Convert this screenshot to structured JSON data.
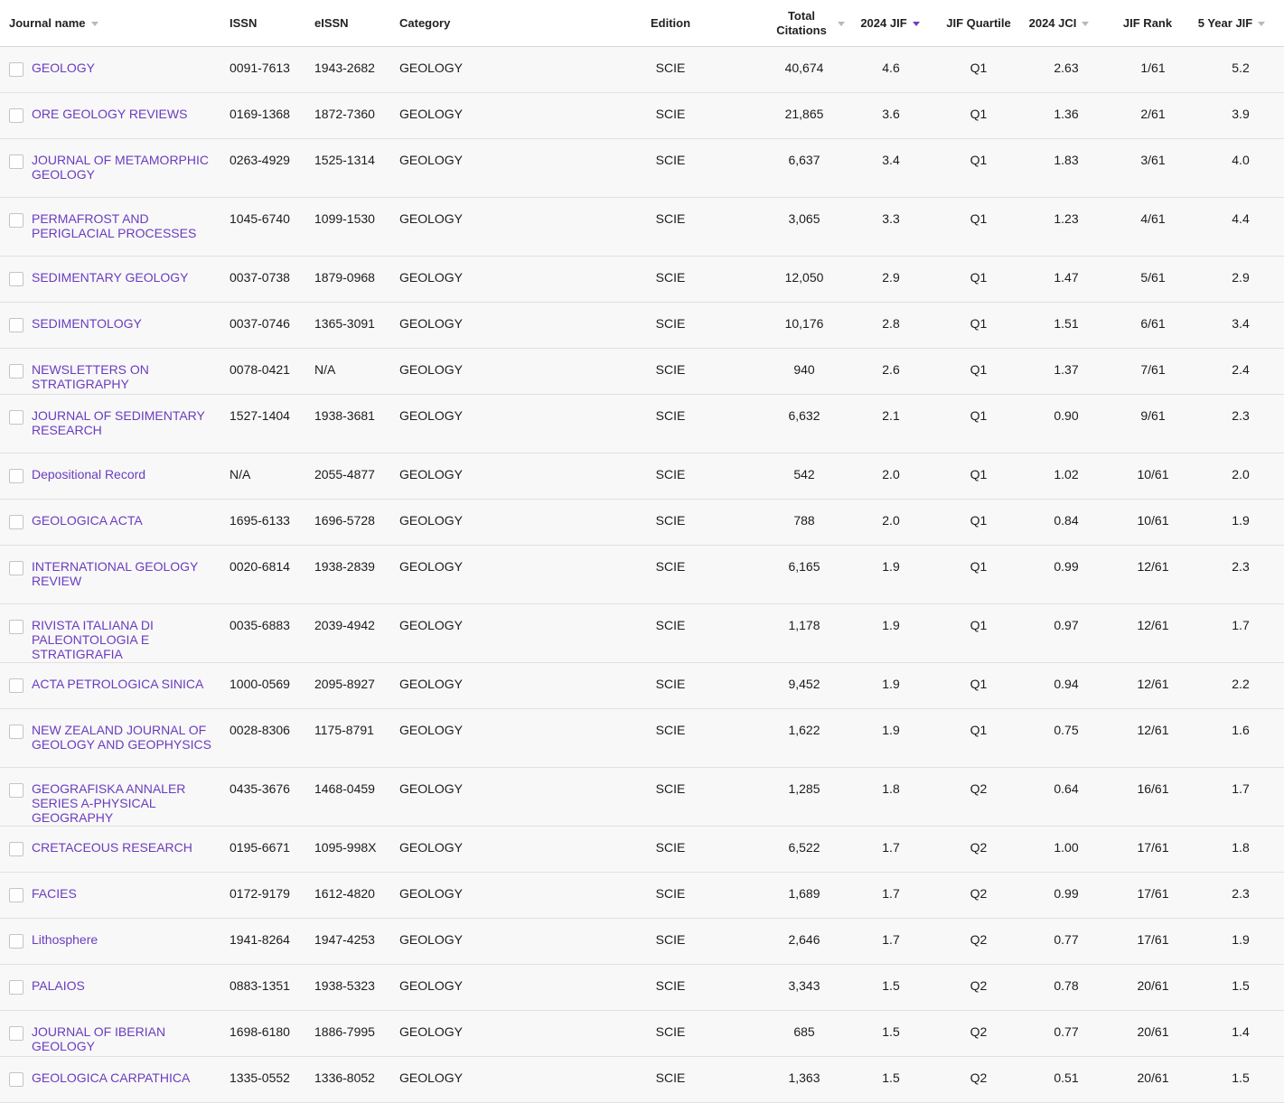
{
  "headers": {
    "journal_name": "Journal name",
    "issn": "ISSN",
    "eissn": "eISSN",
    "category": "Category",
    "edition": "Edition",
    "total_citations_line1": "Total",
    "total_citations_line2": "Citations",
    "jif": "2024 JIF",
    "jif_quartile": "JIF Quartile",
    "jci": "2024 JCI",
    "jif_rank": "JIF Rank",
    "five_year_jif": "5 Year JIF"
  },
  "sort": {
    "active_column": "2024 JIF",
    "active_color": "#6b3fc4",
    "inactive_color": "#b8b8b8"
  },
  "link_color": "#6a3cbf",
  "rows": [
    {
      "name": "GEOLOGY",
      "issn": "0091-7613",
      "eissn": "1943-2682",
      "category": "GEOLOGY",
      "edition": "SCIE",
      "citations": "40,674",
      "jif": "4.6",
      "quartile": "Q1",
      "jci": "2.63",
      "rank": "1/61",
      "five_year": "5.2"
    },
    {
      "name": "ORE GEOLOGY REVIEWS",
      "issn": "0169-1368",
      "eissn": "1872-7360",
      "category": "GEOLOGY",
      "edition": "SCIE",
      "citations": "21,865",
      "jif": "3.6",
      "quartile": "Q1",
      "jci": "1.36",
      "rank": "2/61",
      "five_year": "3.9"
    },
    {
      "name": "JOURNAL OF METAMORPHIC GEOLOGY",
      "issn": "0263-4929",
      "eissn": "1525-1314",
      "category": "GEOLOGY",
      "edition": "SCIE",
      "citations": "6,637",
      "jif": "3.4",
      "quartile": "Q1",
      "jci": "1.83",
      "rank": "3/61",
      "five_year": "4.0"
    },
    {
      "name": "PERMAFROST AND PERIGLACIAL PROCESSES",
      "issn": "1045-6740",
      "eissn": "1099-1530",
      "category": "GEOLOGY",
      "edition": "SCIE",
      "citations": "3,065",
      "jif": "3.3",
      "quartile": "Q1",
      "jci": "1.23",
      "rank": "4/61",
      "five_year": "4.4"
    },
    {
      "name": "SEDIMENTARY GEOLOGY",
      "issn": "0037-0738",
      "eissn": "1879-0968",
      "category": "GEOLOGY",
      "edition": "SCIE",
      "citations": "12,050",
      "jif": "2.9",
      "quartile": "Q1",
      "jci": "1.47",
      "rank": "5/61",
      "five_year": "2.9"
    },
    {
      "name": "SEDIMENTOLOGY",
      "issn": "0037-0746",
      "eissn": "1365-3091",
      "category": "GEOLOGY",
      "edition": "SCIE",
      "citations": "10,176",
      "jif": "2.8",
      "quartile": "Q1",
      "jci": "1.51",
      "rank": "6/61",
      "five_year": "3.4"
    },
    {
      "name": "NEWSLETTERS ON STRATIGRAPHY",
      "issn": "0078-0421",
      "eissn": "N/A",
      "category": "GEOLOGY",
      "edition": "SCIE",
      "citations": "940",
      "jif": "2.6",
      "quartile": "Q1",
      "jci": "1.37",
      "rank": "7/61",
      "five_year": "2.4"
    },
    {
      "name": "JOURNAL OF SEDIMENTARY RESEARCH",
      "issn": "1527-1404",
      "eissn": "1938-3681",
      "category": "GEOLOGY",
      "edition": "SCIE",
      "citations": "6,632",
      "jif": "2.1",
      "quartile": "Q1",
      "jci": "0.90",
      "rank": "9/61",
      "five_year": "2.3"
    },
    {
      "name": "Depositional Record",
      "issn": "N/A",
      "eissn": "2055-4877",
      "category": "GEOLOGY",
      "edition": "SCIE",
      "citations": "542",
      "jif": "2.0",
      "quartile": "Q1",
      "jci": "1.02",
      "rank": "10/61",
      "five_year": "2.0"
    },
    {
      "name": "GEOLOGICA ACTA",
      "issn": "1695-6133",
      "eissn": "1696-5728",
      "category": "GEOLOGY",
      "edition": "SCIE",
      "citations": "788",
      "jif": "2.0",
      "quartile": "Q1",
      "jci": "0.84",
      "rank": "10/61",
      "five_year": "1.9"
    },
    {
      "name": "INTERNATIONAL GEOLOGY REVIEW",
      "issn": "0020-6814",
      "eissn": "1938-2839",
      "category": "GEOLOGY",
      "edition": "SCIE",
      "citations": "6,165",
      "jif": "1.9",
      "quartile": "Q1",
      "jci": "0.99",
      "rank": "12/61",
      "five_year": "2.3"
    },
    {
      "name": "RIVISTA ITALIANA DI PALEONTOLOGIA E STRATIGRAFIA",
      "issn": "0035-6883",
      "eissn": "2039-4942",
      "category": "GEOLOGY",
      "edition": "SCIE",
      "citations": "1,178",
      "jif": "1.9",
      "quartile": "Q1",
      "jci": "0.97",
      "rank": "12/61",
      "five_year": "1.7"
    },
    {
      "name": "ACTA PETROLOGICA SINICA",
      "issn": "1000-0569",
      "eissn": "2095-8927",
      "category": "GEOLOGY",
      "edition": "SCIE",
      "citations": "9,452",
      "jif": "1.9",
      "quartile": "Q1",
      "jci": "0.94",
      "rank": "12/61",
      "five_year": "2.2"
    },
    {
      "name": "NEW ZEALAND JOURNAL OF GEOLOGY AND GEOPHYSICS",
      "issn": "0028-8306",
      "eissn": "1175-8791",
      "category": "GEOLOGY",
      "edition": "SCIE",
      "citations": "1,622",
      "jif": "1.9",
      "quartile": "Q1",
      "jci": "0.75",
      "rank": "12/61",
      "five_year": "1.6"
    },
    {
      "name": "GEOGRAFISKA ANNALER SERIES A-PHYSICAL GEOGRAPHY",
      "issn": "0435-3676",
      "eissn": "1468-0459",
      "category": "GEOLOGY",
      "edition": "SCIE",
      "citations": "1,285",
      "jif": "1.8",
      "quartile": "Q2",
      "jci": "0.64",
      "rank": "16/61",
      "five_year": "1.7"
    },
    {
      "name": "CRETACEOUS RESEARCH",
      "issn": "0195-6671",
      "eissn": "1095-998X",
      "category": "GEOLOGY",
      "edition": "SCIE",
      "citations": "6,522",
      "jif": "1.7",
      "quartile": "Q2",
      "jci": "1.00",
      "rank": "17/61",
      "five_year": "1.8"
    },
    {
      "name": "FACIES",
      "issn": "0172-9179",
      "eissn": "1612-4820",
      "category": "GEOLOGY",
      "edition": "SCIE",
      "citations": "1,689",
      "jif": "1.7",
      "quartile": "Q2",
      "jci": "0.99",
      "rank": "17/61",
      "five_year": "2.3"
    },
    {
      "name": "Lithosphere",
      "issn": "1941-8264",
      "eissn": "1947-4253",
      "category": "GEOLOGY",
      "edition": "SCIE",
      "citations": "2,646",
      "jif": "1.7",
      "quartile": "Q2",
      "jci": "0.77",
      "rank": "17/61",
      "five_year": "1.9"
    },
    {
      "name": "PALAIOS",
      "issn": "0883-1351",
      "eissn": "1938-5323",
      "category": "GEOLOGY",
      "edition": "SCIE",
      "citations": "3,343",
      "jif": "1.5",
      "quartile": "Q2",
      "jci": "0.78",
      "rank": "20/61",
      "five_year": "1.5"
    },
    {
      "name": "JOURNAL OF IBERIAN GEOLOGY",
      "issn": "1698-6180",
      "eissn": "1886-7995",
      "category": "GEOLOGY",
      "edition": "SCIE",
      "citations": "685",
      "jif": "1.5",
      "quartile": "Q2",
      "jci": "0.77",
      "rank": "20/61",
      "five_year": "1.4"
    },
    {
      "name": "GEOLOGICA CARPATHICA",
      "issn": "1335-0552",
      "eissn": "1336-8052",
      "category": "GEOLOGY",
      "edition": "SCIE",
      "citations": "1,363",
      "jif": "1.5",
      "quartile": "Q2",
      "jci": "0.51",
      "rank": "20/61",
      "five_year": "1.5"
    }
  ]
}
